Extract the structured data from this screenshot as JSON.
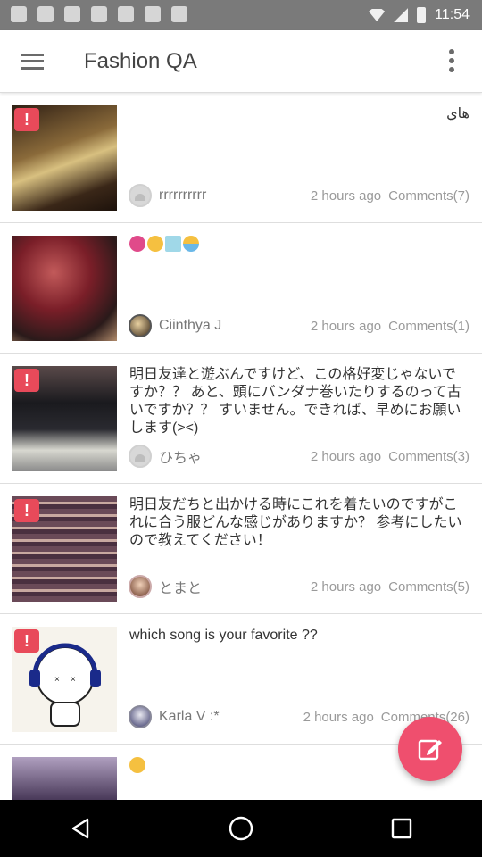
{
  "status_bar": {
    "time": "11:54"
  },
  "app_bar": {
    "title": "Fashion QA"
  },
  "posts": [
    {
      "text": "هاي",
      "rtl": true,
      "author": "rrrrrrrrrr",
      "time": "2 hours ago",
      "comments": "Comments(7)",
      "flagged": true,
      "thumb_color": "#5a3c28"
    },
    {
      "text": "",
      "author": "Ciinthya J",
      "time": "2 hours ago",
      "comments": "Comments(1)",
      "flagged": false,
      "thumb_color": "#8a2a33"
    },
    {
      "text": "明日友達と遊ぶんですけど、この格好変じゃないですか？？ あと、頭にバンダナ巻いたりするのって古いですか？？ すいません。できれば、早めにお願いします(><)",
      "author": "ひちゃ",
      "time": "2 hours ago",
      "comments": "Comments(3)",
      "flagged": true,
      "thumb_color": "#3c3c44"
    },
    {
      "text": "明日友だちと出かける時にこれを着たいのですがこれに合う服どんな感じがありますか？ 参考にしたいので教えてください！",
      "author": "とまと",
      "time": "2 hours ago",
      "comments": "Comments(5)",
      "flagged": true,
      "thumb_color": "#7a5a66"
    },
    {
      "text": "which song is your favorite ??",
      "author": "Karla V :*",
      "time": "2 hours ago",
      "comments": "Comments(26)",
      "flagged": true,
      "thumb_color": "#f4f1ea"
    },
    {
      "text": "",
      "author": "",
      "time": "",
      "comments": "",
      "flagged": false,
      "thumb_color": "#6a5870"
    }
  ],
  "icons": {
    "menu": "hamburger-icon",
    "overflow": "more-vert-icon",
    "flag": "alert-icon",
    "fab": "compose-icon",
    "nav_back": "back-triangle-icon",
    "nav_home": "home-circle-icon",
    "nav_recent": "recents-square-icon"
  },
  "colors": {
    "accent": "#ef4f6e",
    "flag": "#e84a5a",
    "meta_text": "#9a9a9a"
  }
}
